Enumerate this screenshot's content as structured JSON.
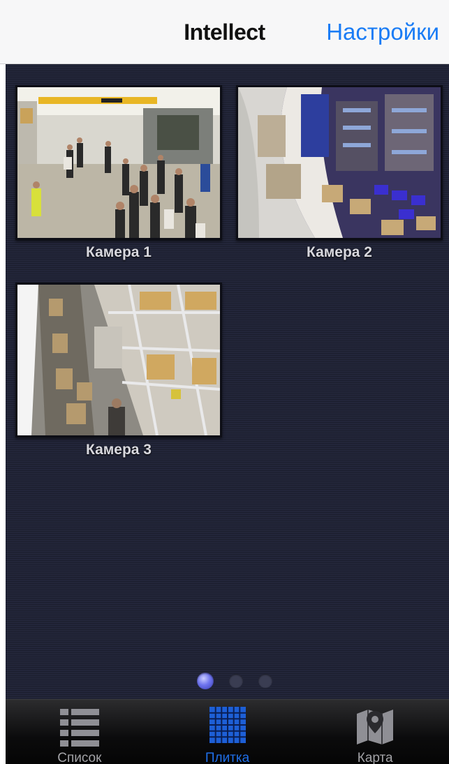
{
  "navbar": {
    "title": "Intellect",
    "settings_label": "Настройки"
  },
  "cameras": [
    {
      "label": "Камера 1"
    },
    {
      "label": "Камера 2"
    },
    {
      "label": "Камера 3"
    }
  ],
  "pager": {
    "current": 1,
    "total": 3
  },
  "tabbar": {
    "items": [
      {
        "label": "Список",
        "icon": "list-icon"
      },
      {
        "label": "Плитка",
        "icon": "grid-icon",
        "active": true
      },
      {
        "label": "Карта",
        "icon": "map-icon"
      }
    ]
  },
  "colors": {
    "accent": "#1a7cf5",
    "active_tab": "#1f6fe8",
    "content_bg": "#23263a"
  }
}
